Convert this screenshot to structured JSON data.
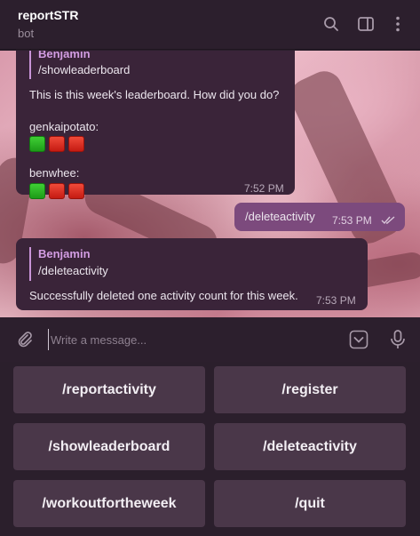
{
  "header": {
    "title": "reportSTR",
    "subtitle": "bot"
  },
  "messages": {
    "m1": {
      "quote_name": "Benjamin",
      "quote_text": "/showleaderboard",
      "line1": "This is this week's leaderboard. How did you do?",
      "user1": "genkaipotato:",
      "user2": "benwhee:",
      "time": "7:52 PM"
    },
    "m2": {
      "text": "/deleteactivity",
      "time": "7:53 PM"
    },
    "m3": {
      "quote_name": "Benjamin",
      "quote_text": "/deleteactivity",
      "text": "Successfully deleted one activity count for this week.",
      "time": "7:53 PM"
    }
  },
  "composer": {
    "placeholder": "Write a message..."
  },
  "keyboard": {
    "b1": "/reportactivity",
    "b2": "/register",
    "b3": "/showleaderboard",
    "b4": "/deleteactivity",
    "b5": "/workoutfortheweek",
    "b6": "/quit"
  },
  "colors": {
    "accent": "#c994d8",
    "outgoing_bubble": "#7c4a7d",
    "incoming_bubble": "#3a2439",
    "green_square": "#2db826",
    "red_square": "#dd2b20"
  },
  "icons": [
    "search-icon",
    "sidebar-toggle-icon",
    "more-vertical-icon",
    "paperclip-icon",
    "keyboard-toggle-icon",
    "microphone-icon",
    "double-check-icon"
  ]
}
